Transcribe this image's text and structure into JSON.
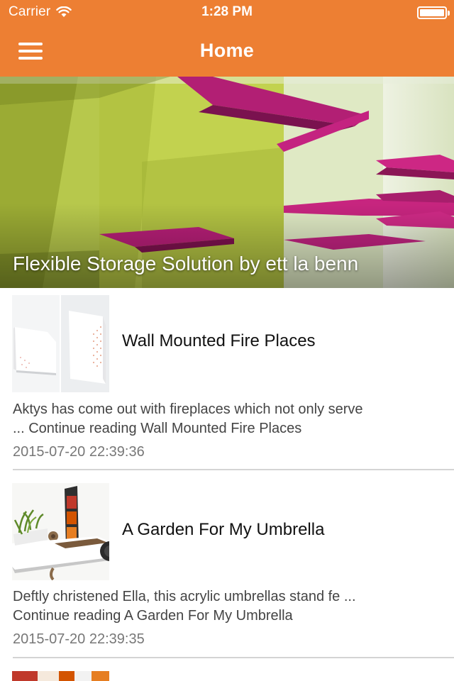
{
  "status_bar": {
    "carrier": "Carrier",
    "time": "1:28 PM",
    "wifi_icon": "wifi-icon",
    "battery_icon": "battery-icon"
  },
  "nav_bar": {
    "title": "Home",
    "menu_icon": "hamburger-menu-icon",
    "background_color": "#ED7F33"
  },
  "featured": {
    "title": "Flexible Storage Solution by ett la benn"
  },
  "articles": [
    {
      "title": "Wall Mounted Fire Places",
      "excerpt_line1": "Aktys has come out with fireplaces which not only serve",
      "excerpt_line2": "... Continue reading Wall Mounted Fire Places",
      "date": "2015-07-20 22:39:36"
    },
    {
      "title": "A Garden For My Umbrella",
      "excerpt_line1": "Deftly christened Ella, this acrylic umbrellas stand fe ...",
      "excerpt_line2": "Continue reading A Garden For My Umbrella",
      "date": "2015-07-20 22:39:35"
    }
  ]
}
